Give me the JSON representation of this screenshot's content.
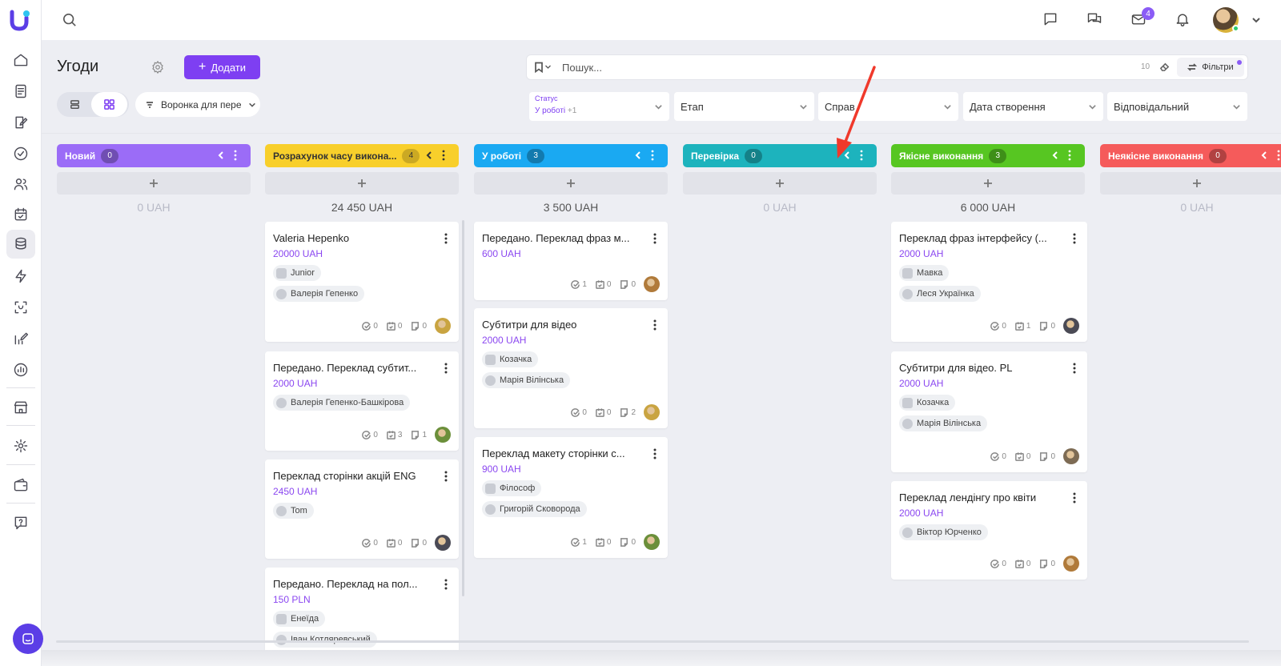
{
  "topbar": {
    "mail_badge": "4"
  },
  "page": {
    "title": "Угоди",
    "add_label": "Додати",
    "pipeline": "Воронка для пере"
  },
  "search": {
    "placeholder": "Пошук...",
    "count": "10",
    "filters_label": "Фільтри"
  },
  "filters": {
    "status_label": "Статус",
    "status_value": "У роботі",
    "status_extra": "+1",
    "stage": "Етап",
    "cases": "Справ",
    "created": "Дата створення",
    "responsible": "Відповідальний"
  },
  "colors": {
    "accent": "#7e3ff2",
    "amount": "#8b47f0"
  },
  "columns": [
    {
      "name": "Новий",
      "count": "0",
      "sum": "0 UAH",
      "color": "#9b6cf7"
    },
    {
      "name": "Розрахунок часу викона...",
      "count": "4",
      "sum": "24 450 UAH",
      "color": "#f8cf2b"
    },
    {
      "name": "У роботі",
      "count": "3",
      "sum": "3 500 UAH",
      "color": "#1aa9f2"
    },
    {
      "name": "Перевірка",
      "count": "0",
      "sum": "0 UAH",
      "color": "#1db3bd"
    },
    {
      "name": "Якісне виконання",
      "count": "3",
      "sum": "6 000 UAH",
      "color": "#57c622"
    },
    {
      "name": "Неякісне виконання",
      "count": "0",
      "sum": "0 UAH",
      "color": "#f55b5b"
    }
  ],
  "cards": [
    {
      "title": "Valeria Hepenko",
      "amount": "20000 UAH",
      "tag1": "Junior",
      "tag2": "Валерія Гепенко",
      "tasks": "0",
      "events": "0",
      "notes": "0"
    },
    {
      "title": "Передано. Переклад субтит...",
      "amount": "2000 UAH",
      "tag1": "Валерія Гепенко-Башкірова",
      "tasks": "0",
      "events": "3",
      "notes": "1"
    },
    {
      "title": "Переклад сторінки акцій ENG",
      "amount": "2450 UAH",
      "tag1": "Tom",
      "tasks": "0",
      "events": "0",
      "notes": "0"
    },
    {
      "title": "Передано. Переклад на пол...",
      "amount": "150 PLN",
      "tag1": "Енеїда",
      "tag2": "Іван Котляревський"
    },
    {
      "title": "Передано. Переклад фраз м...",
      "amount": "600 UAH",
      "tasks": "1",
      "events": "0",
      "notes": "0"
    },
    {
      "title": "Субтитри для відео",
      "amount": "2000 UAH",
      "tag1": "Козачка",
      "tag2": "Марія Вілінська",
      "tasks": "0",
      "events": "0",
      "notes": "2"
    },
    {
      "title": "Переклад макету сторінки с...",
      "amount": "900 UAH",
      "tag1": "Філософ",
      "tag2": "Григорій Сковорода",
      "tasks": "1",
      "events": "0",
      "notes": "0"
    },
    {
      "title": "Переклад фраз інтерфейсу (...",
      "amount": "2000 UAH",
      "tag1": "Мавка",
      "tag2": "Леся Українка",
      "tasks": "0",
      "events": "1",
      "notes": "0"
    },
    {
      "title": "Субтитри для відео. PL",
      "amount": "2000 UAH",
      "tag1": "Козачка",
      "tag2": "Марія Вілінська",
      "tasks": "0",
      "events": "0",
      "notes": "0"
    },
    {
      "title": "Переклад лендінгу про квіти",
      "amount": "2000 UAH",
      "tag1": "Віктор Юрченко",
      "tasks": "0",
      "events": "0",
      "notes": "0"
    }
  ]
}
